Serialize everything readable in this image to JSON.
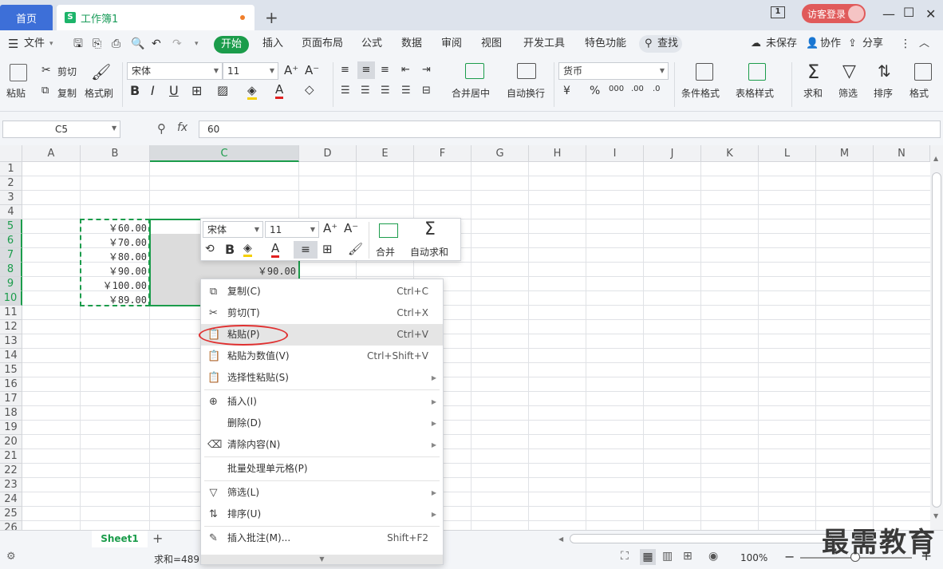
{
  "tabs": {
    "home": "首页",
    "doc": "工作簿1",
    "doc_icon": "S",
    "new_tab": "+"
  },
  "titlebar": {
    "login": "访客登录",
    "page_count": "1",
    "minimize": "—",
    "maximize": "☐",
    "close": "✕"
  },
  "menubar": {
    "file": "文件",
    "items": [
      "开始",
      "插入",
      "页面布局",
      "公式",
      "数据",
      "审阅",
      "视图",
      "开发工具",
      "特色功能"
    ],
    "search": "查找",
    "unsaved": "未保存",
    "collab": "协作",
    "share": "分享"
  },
  "ribbon": {
    "paste": "粘贴",
    "cut": "剪切",
    "copy": "复制",
    "format_painter": "格式刷",
    "font": "宋体",
    "size": "11",
    "merge_center": "合并居中",
    "wrap": "自动换行",
    "number_format": "货币",
    "cond_format": "条件格式",
    "table_style": "表格样式",
    "sum": "求和",
    "filter": "筛选",
    "sort": "排序",
    "format": "格式"
  },
  "formula_bar": {
    "name_box": "C5",
    "fx": "fx",
    "value": "60"
  },
  "columns": [
    "A",
    "B",
    "C",
    "D",
    "E",
    "F",
    "G",
    "H",
    "I",
    "J",
    "K",
    "L",
    "M",
    "N"
  ],
  "rows": [
    "1",
    "2",
    "3",
    "4",
    "5",
    "6",
    "7",
    "8",
    "9",
    "10",
    "11",
    "12",
    "13",
    "14",
    "15",
    "16",
    "17",
    "18",
    "19",
    "20",
    "21",
    "22",
    "23",
    "24",
    "25",
    "26"
  ],
  "cells": {
    "b_values": [
      "￥60.00",
      "￥70.00",
      "￥80.00",
      "￥90.00",
      "￥100.00",
      "￥89.00"
    ],
    "c8": "￥90.00"
  },
  "mini_toolbar": {
    "font": "宋体",
    "size": "11",
    "merge": "合并",
    "autosum": "自动求和"
  },
  "context_menu": {
    "items": [
      {
        "label": "复制(C)",
        "shortcut": "Ctrl+C"
      },
      {
        "label": "剪切(T)",
        "shortcut": "Ctrl+X"
      },
      {
        "label": "粘贴(P)",
        "shortcut": "Ctrl+V"
      },
      {
        "label": "粘贴为数值(V)",
        "shortcut": "Ctrl+Shift+V"
      },
      {
        "label": "选择性粘贴(S)",
        "shortcut": ""
      },
      {
        "label": "插入(I)",
        "shortcut": ""
      },
      {
        "label": "删除(D)",
        "shortcut": ""
      },
      {
        "label": "清除内容(N)",
        "shortcut": ""
      },
      {
        "label": "批量处理单元格(P)",
        "shortcut": ""
      },
      {
        "label": "筛选(L)",
        "shortcut": ""
      },
      {
        "label": "排序(U)",
        "shortcut": ""
      },
      {
        "label": "插入批注(M)...",
        "shortcut": "Shift+F2"
      }
    ]
  },
  "sheet_tabs": {
    "active": "Sheet1",
    "add": "+"
  },
  "status": {
    "sum": "求和=489",
    "zoom": "100%"
  },
  "watermark": "最需教育",
  "colors": {
    "accent": "#1b9c4b",
    "home_tab": "#3d6fd8",
    "highlight_ring": "#e03030"
  }
}
